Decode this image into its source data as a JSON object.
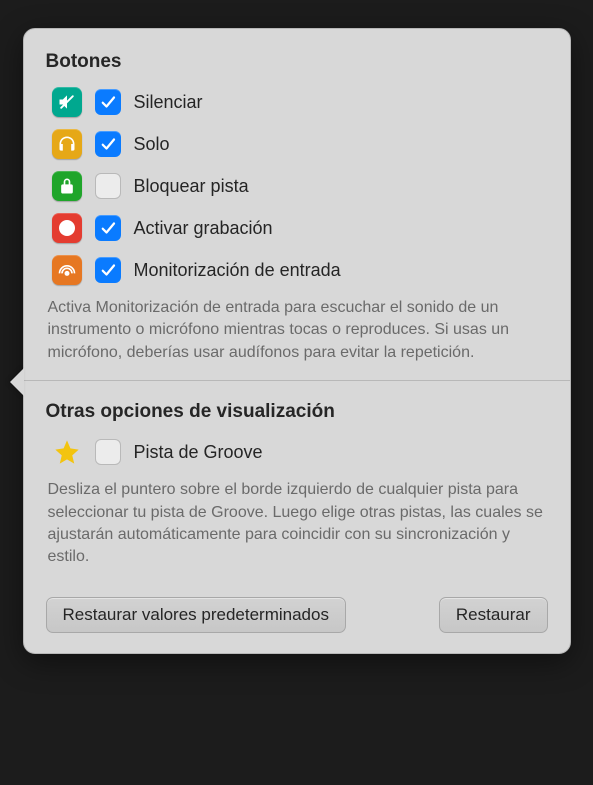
{
  "sections": {
    "buttons": {
      "title": "Botones",
      "options": [
        {
          "label": "Silenciar",
          "checked": true
        },
        {
          "label": "Solo",
          "checked": true
        },
        {
          "label": "Bloquear pista",
          "checked": false
        },
        {
          "label": "Activar grabación",
          "checked": true
        },
        {
          "label": "Monitorización de entrada",
          "checked": true
        }
      ],
      "description": "Activa Monitorización de entrada para escuchar el sonido de un instrumento o micrófono mientras tocas o reproduces. Si usas un micrófono, deberías usar audífonos para evitar la repetición."
    },
    "display": {
      "title": "Otras opciones de visualización",
      "options": [
        {
          "label": "Pista de Groove",
          "checked": false
        }
      ],
      "description": "Desliza el puntero sobre el borde izquierdo de cualquier pista para seleccionar tu pista de Groove. Luego elige otras pistas, las cuales se ajustarán automáticamente para coincidir con su sincronización y estilo."
    }
  },
  "footer": {
    "restore_defaults": "Restaurar valores predeterminados",
    "restore": "Restaurar"
  }
}
